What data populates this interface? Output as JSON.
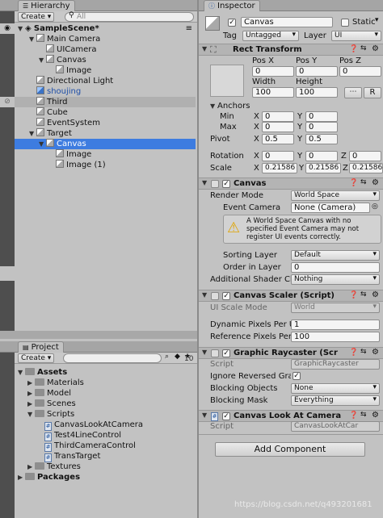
{
  "hierarchy": {
    "tab": "Hierarchy",
    "create": "Create ▾",
    "search_placeholder": "All",
    "scene": "SampleScene*",
    "items": [
      {
        "label": "Main Camera",
        "depth": 1
      },
      {
        "label": "UICamera",
        "depth": 2
      },
      {
        "label": "Canvas",
        "depth": 2
      },
      {
        "label": "Image",
        "depth": 3
      },
      {
        "label": "Directional Light",
        "depth": 1
      },
      {
        "label": "shoujing",
        "depth": 1
      },
      {
        "label": "Third",
        "depth": 1
      },
      {
        "label": "Cube",
        "depth": 1
      },
      {
        "label": "EventSystem",
        "depth": 1
      },
      {
        "label": "Target",
        "depth": 1
      },
      {
        "label": "Canvas",
        "depth": 2
      },
      {
        "label": "Image",
        "depth": 3
      },
      {
        "label": "Image (1)",
        "depth": 3
      }
    ]
  },
  "project": {
    "tab": "Project",
    "create": "Create ▾",
    "assets": "Assets",
    "materials": "Materials",
    "model": "Model",
    "scenes": "Scenes",
    "scripts": "Scripts",
    "script_files": [
      "CanvasLookAtCamera",
      "Test4LineControl",
      "ThirdCameraControl",
      "TransTarget"
    ],
    "textures": "Textures",
    "packages": "Packages",
    "badge": "10"
  },
  "inspector": {
    "tab": "Inspector",
    "name": "Canvas",
    "static_label": "Static",
    "tag_label": "Tag",
    "tag_value": "Untagged",
    "layer_label": "Layer",
    "layer_value": "UI",
    "rect": {
      "title": "Rect Transform",
      "pos_x": "Pos X",
      "pos_y": "Pos Y",
      "pos_z": "Pos Z",
      "pos_x_val": "0",
      "pos_y_val": "0",
      "pos_z_val": "0",
      "width": "Width",
      "height": "Height",
      "width_val": "100",
      "height_val": "100",
      "r": "R",
      "anchors": "Anchors",
      "min": "Min",
      "max": "Max",
      "x": "X",
      "y": "Y",
      "z": "Z",
      "min_x": "0",
      "min_y": "0",
      "max_x": "0",
      "max_y": "0",
      "pivot": "Pivot",
      "pivot_x": "0.5",
      "pivot_y": "0.5",
      "rotation": "Rotation",
      "rot_x": "0",
      "rot_y": "0",
      "rot_z": "0",
      "scale": "Scale",
      "scale_x": "0.21586",
      "scale_y": "0.21586",
      "scale_z": "0.21586"
    },
    "canvas": {
      "title": "Canvas",
      "render_mode": "Render Mode",
      "render_mode_val": "World Space",
      "event_camera": "Event Camera",
      "event_camera_val": "None (Camera)",
      "warning": "A World Space Canvas with no specified Event Camera may not register UI events correctly.",
      "sorting_layer": "Sorting Layer",
      "sorting_layer_val": "Default",
      "order": "Order in Layer",
      "order_val": "0",
      "shader": "Additional Shader Ch",
      "shader_val": "Nothing"
    },
    "scaler": {
      "title": "Canvas Scaler (Script)",
      "ui_scale": "UI Scale Mode",
      "ui_scale_val": "World",
      "dpp": "Dynamic Pixels Per U",
      "dpp_val": "1",
      "rpp": "Reference Pixels Per",
      "rpp_val": "100"
    },
    "raycaster": {
      "title": "Graphic Raycaster (Scr",
      "script": "Script",
      "script_val": "GraphicRaycaster",
      "ignore": "Ignore Reversed Gra",
      "blocking_obj": "Blocking Objects",
      "blocking_obj_val": "None",
      "blocking_mask": "Blocking Mask",
      "blocking_mask_val": "Everything"
    },
    "lookat": {
      "title": "Canvas Look At Camera",
      "script": "Script",
      "script_val": "CanvasLookAtCar"
    },
    "add_component": "Add Component"
  },
  "watermark": "https://blog.csdn.net/q493201681"
}
